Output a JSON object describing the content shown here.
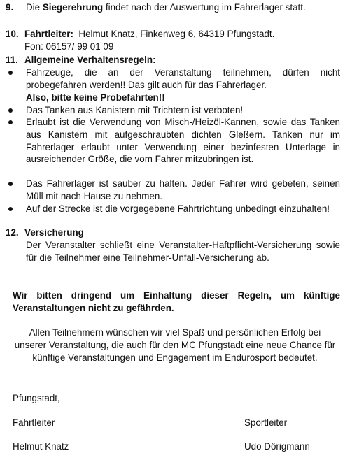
{
  "section9": {
    "num": "9.",
    "pre": "Die ",
    "bold": "Siegerehrung",
    "post": " findet nach der Auswertung im Fahrerlager statt."
  },
  "section10": {
    "num": "10.",
    "heading": "Fahrtleiter:",
    "line1": "Helmut Knatz, Finkenweg 6, 64319 Pfungstadt.",
    "line2": "Fon: 06157/ 99 01 09"
  },
  "section11": {
    "num": "11.",
    "heading": "Allgemeine Verhaltensregeln:",
    "bullets": [
      {
        "text": "Fahrzeuge, die an der Veranstaltung teilnehmen, dürfen nicht probegefahren werden!! Das gilt auch für das Fahrerlager.",
        "bold": "Also, bitte keine Probefahrten!!"
      },
      {
        "text": "Das Tanken aus Kanistern mit Trichtern ist verboten!"
      },
      {
        "text": "Erlaubt ist die Verwendung von Misch-/Heizöl-Kannen, sowie das Tanken aus Kanistern mit aufgeschraubten dichten Gleßern. Tanken nur im Fahrerlager erlaubt unter Verwendung einer bezinfesten Unterlage in ausreichender Größe, die vom Fahrer mitzubringen ist."
      },
      {
        "text": "Das Fahrerlager ist sauber zu halten. Jeder Fahrer wird gebeten, seinen Müll mit nach Hause zu nehmen."
      },
      {
        "text": "Auf der Strecke ist die vorgegebene Fahrtrichtung unbedingt einzuhalten!"
      }
    ]
  },
  "section12": {
    "num": "12.",
    "heading": "Versicherung",
    "text": "Der Veranstalter schließt eine Veranstalter-Haftpflicht-Versicherung sowie für die Teilnehmer eine Teilnehmer-Unfall-Versicherung ab."
  },
  "appeal": "Wir bitten dringend um Einhaltung dieser Regeln, um künftige Veranstaltungen nicht zu gefährden.",
  "wish": "Allen Teilnehmern wünschen wir viel Spaß und persönlichen Erfolg bei unserer Veranstaltung, die auch für den MC Pfungstadt eine neue Chance für künftige Veranstaltungen und Engagement im Endurosport bedeutet.",
  "place": "Pfungstadt,",
  "signatures": {
    "left_role": "Fahrtleiter",
    "right_role": "Sportleiter",
    "left_name": "Helmut Knatz",
    "right_name": "Udo Dörigmann"
  }
}
